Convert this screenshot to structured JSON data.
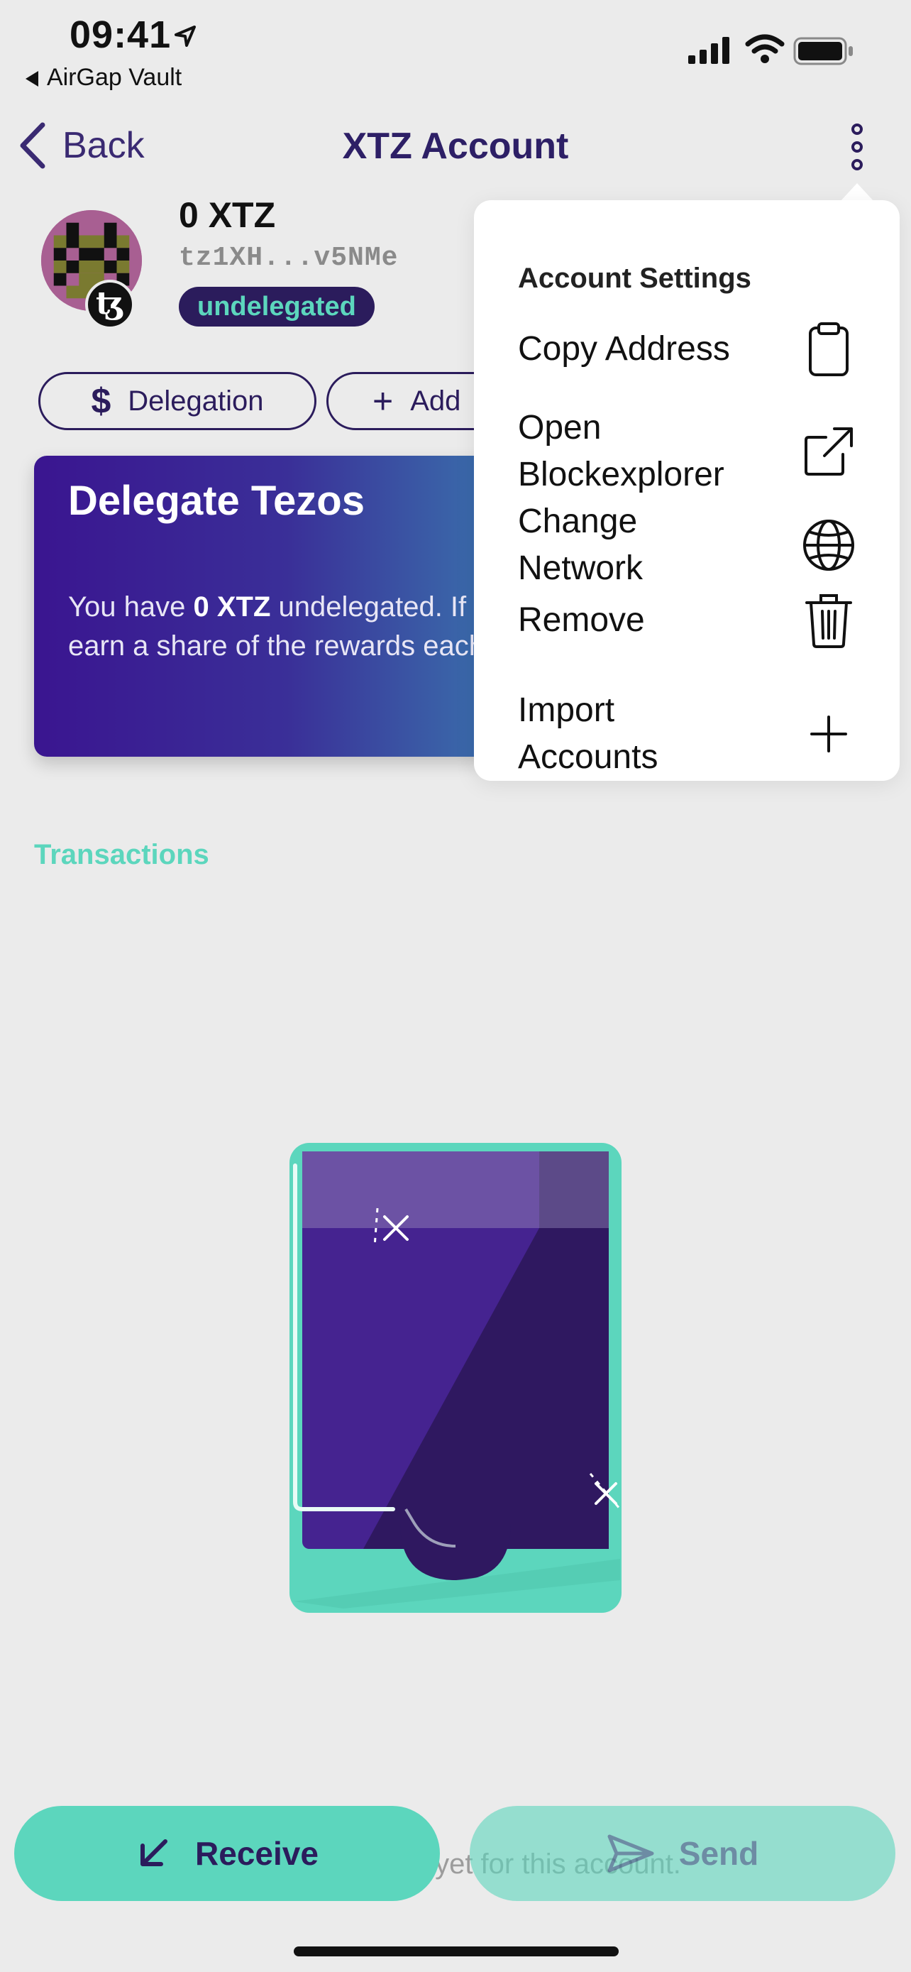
{
  "status_bar": {
    "time": "09:41",
    "back_app": "AirGap Vault"
  },
  "nav": {
    "back_label": "Back",
    "title": "XTZ Account"
  },
  "account": {
    "balance": "0 XTZ",
    "address": "tz1XH...v5NMe",
    "status": "undelegated",
    "badge_symbol": "ꜩ"
  },
  "actions": {
    "delegation_symbol": "$",
    "delegation_label": "Delegation",
    "add_symbol": "+",
    "add_label": "Add"
  },
  "delegate_card": {
    "title": "Delegate Tezos",
    "body_prefix": "You have ",
    "body_amount": "0 XTZ",
    "body_suffix": " undelegated. If you delegate now you can earn a share of the rewards each cycle."
  },
  "transactions": {
    "header": "Transactions",
    "empty_text": "No transactions yet for this account."
  },
  "buttons": {
    "receive": "Receive",
    "send": "Send"
  },
  "menu": {
    "heading": "Account Settings",
    "items": [
      {
        "label": "Copy Address",
        "icon": "clipboard-icon"
      },
      {
        "label": "Open Blockexplorer",
        "icon": "external-link-icon"
      },
      {
        "label": "Change Network",
        "icon": "globe-icon"
      },
      {
        "label": "Remove",
        "icon": "trash-icon"
      },
      {
        "label": "Import Accounts",
        "icon": "plus-icon"
      }
    ]
  },
  "colors": {
    "accent": "#5cd6bd",
    "primary": "#2b1c5c",
    "background": "#ebebeb"
  }
}
